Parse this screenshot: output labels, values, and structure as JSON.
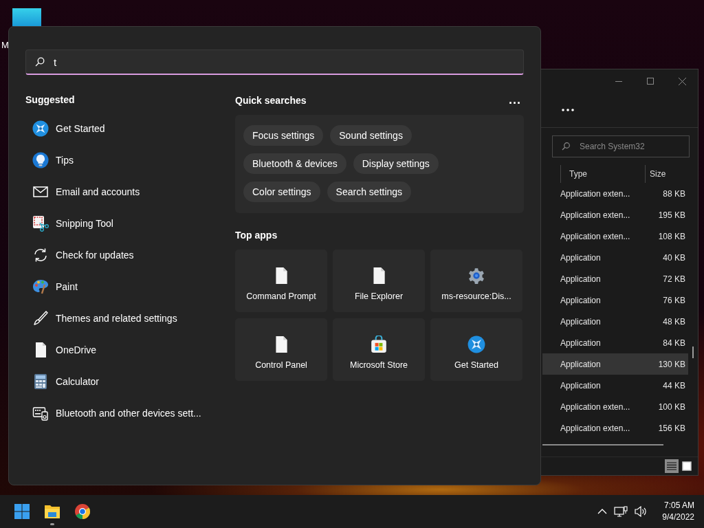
{
  "desktop": {
    "icons": [
      {
        "label": "M"
      }
    ]
  },
  "explorer": {
    "search": {
      "placeholder": "Search System32"
    },
    "columns": [
      "Type",
      "Size"
    ],
    "rows": [
      {
        "type": "Application exten...",
        "size": "88 KB",
        "selected": false
      },
      {
        "type": "Application exten...",
        "size": "195 KB",
        "selected": false
      },
      {
        "type": "Application exten...",
        "size": "108 KB",
        "selected": false
      },
      {
        "type": "Application",
        "size": "40 KB",
        "selected": false
      },
      {
        "type": "Application",
        "size": "72 KB",
        "selected": false
      },
      {
        "type": "Application",
        "size": "76 KB",
        "selected": false
      },
      {
        "type": "Application",
        "size": "48 KB",
        "selected": false
      },
      {
        "type": "Application",
        "size": "84 KB",
        "selected": false
      },
      {
        "type": "Application",
        "size": "130 KB",
        "selected": true
      },
      {
        "type": "Application",
        "size": "44 KB",
        "selected": false
      },
      {
        "type": "Application exten...",
        "size": "100 KB",
        "selected": false
      },
      {
        "type": "Application exten...",
        "size": "156 KB",
        "selected": false
      }
    ],
    "view_buttons": [
      {
        "kind": "details",
        "selected": true
      },
      {
        "kind": "tiles",
        "selected": false
      }
    ]
  },
  "search_panel": {
    "query": "t",
    "suggested": {
      "title": "Suggested",
      "items": [
        {
          "label": "Get Started",
          "kind": "star"
        },
        {
          "label": "Tips",
          "kind": "bulb"
        },
        {
          "label": "Email and accounts",
          "kind": "mail"
        },
        {
          "label": "Snipping Tool",
          "kind": "snip"
        },
        {
          "label": "Check for updates",
          "kind": "refresh"
        },
        {
          "label": "Paint",
          "kind": "palette"
        },
        {
          "label": "Themes and related settings",
          "kind": "brush"
        },
        {
          "label": "OneDrive",
          "kind": "document"
        },
        {
          "label": "Calculator",
          "kind": "calculator"
        },
        {
          "label": "Bluetooth and other devices sett...",
          "kind": "devices"
        }
      ]
    },
    "quick_searches": {
      "title": "Quick searches",
      "more": "...",
      "chips": [
        [
          "Focus settings",
          "Sound settings"
        ],
        [
          "Bluetooth & devices",
          "Display settings"
        ],
        [
          "Color settings",
          "Search settings"
        ]
      ]
    },
    "top_apps": {
      "title": "Top apps",
      "apps": [
        {
          "label": "Command Prompt",
          "kind": "document"
        },
        {
          "label": "File Explorer",
          "kind": "document"
        },
        {
          "label": "ms-resource:Dis...",
          "kind": "gear"
        },
        {
          "label": "Control Panel",
          "kind": "document"
        },
        {
          "label": "Microsoft Store",
          "kind": "store"
        },
        {
          "label": "Get Started",
          "kind": "star"
        }
      ]
    }
  },
  "taskbar": {
    "apps": [
      {
        "kind": "start",
        "running": false
      },
      {
        "kind": "folder",
        "running": true
      },
      {
        "kind": "chrome",
        "running": false
      }
    ],
    "time": "7:05 AM",
    "date": "9/4/2022"
  }
}
